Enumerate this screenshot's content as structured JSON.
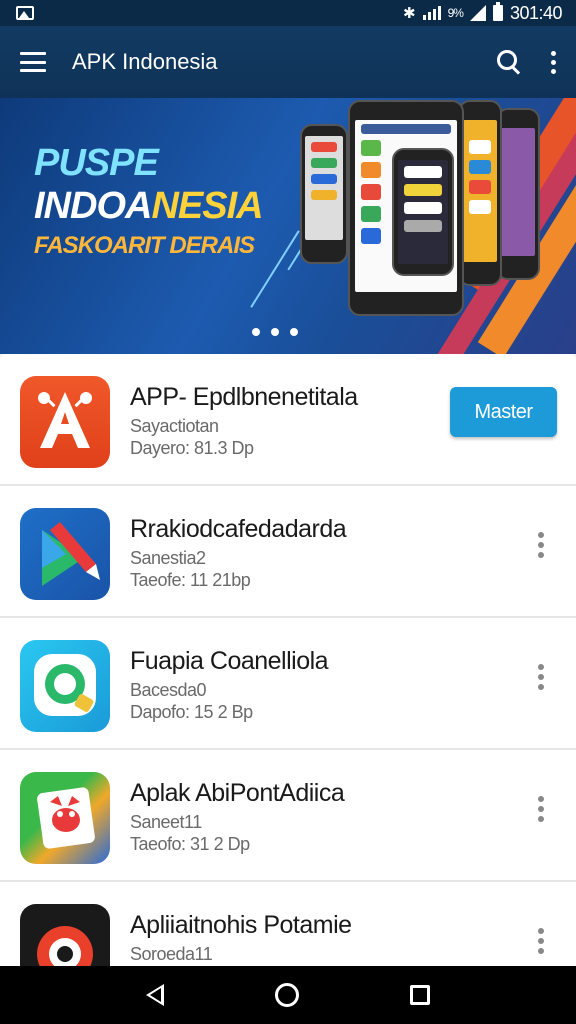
{
  "status_bar": {
    "time": "301:40",
    "battery_text": "9%",
    "icons": [
      "gallery-icon",
      "bluetooth-icon",
      "signal-icon",
      "wifi-icon",
      "battery-icon"
    ]
  },
  "app_bar": {
    "title": "APK Indonesia",
    "icons": [
      "menu-icon",
      "search-icon",
      "more-vert-icon"
    ]
  },
  "banner": {
    "line1": "PUSPE",
    "line2_a": "INDOA",
    "line2_b": "NESIA",
    "line3": "FASKOARIT DERAIS",
    "page_dots": 3
  },
  "apps": [
    {
      "title": "APP- Epdlbnenetitala",
      "subtitle": "Sayactiotan",
      "meta": "Dayero: 81.3 Dp",
      "action": "Master",
      "icon": "a-logo-icon"
    },
    {
      "title": "Rrakiodcafedadarda",
      "subtitle": "Sanestia2",
      "meta": "Taeofe: 11 21bp",
      "icon": "play-pen-icon"
    },
    {
      "title": "Fuapia Coanelliola",
      "subtitle": "Bacesda0",
      "meta": "Dapofo: 15 2 Bp",
      "icon": "chat-bubble-icon"
    },
    {
      "title": "Aplak AbiPontAdiica",
      "subtitle": "Saneet11",
      "meta": "Taeofo: 31 2 Dp",
      "icon": "face-card-icon"
    },
    {
      "title": "Apliiaitnohis Potamie",
      "subtitle": "Soroeda11",
      "meta": "",
      "icon": "red-eye-icon"
    }
  ],
  "colors": {
    "app_bar": "#123a62",
    "status_bar": "#0b2a47",
    "accent_button": "#1d9ad8"
  }
}
